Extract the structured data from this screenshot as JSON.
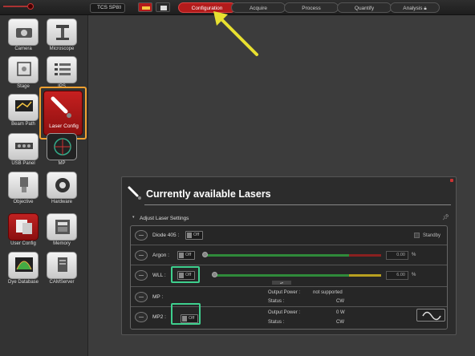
{
  "topbar": {
    "config_select": "TCS SP8",
    "steps": [
      "Configuration",
      "Acquire",
      "Process",
      "Quantify",
      "Analysis"
    ]
  },
  "sidebar": {
    "tools": [
      {
        "label": "Camera"
      },
      {
        "label": "Microscope"
      },
      {
        "label": "Stage"
      },
      {
        "label": "IPS"
      },
      {
        "label": "Beam Path"
      },
      {
        "label": "Laser Config"
      },
      {
        "label": "USB Panel"
      },
      {
        "label": "MP"
      },
      {
        "label": "Objective"
      },
      {
        "label": "Hardware"
      },
      {
        "label": "User Config"
      },
      {
        "label": "Memory"
      },
      {
        "label": "Dye Database"
      },
      {
        "label": "CAMServer"
      }
    ]
  },
  "panel": {
    "title": "Currently available Lasers",
    "section": "Adjust Laser Settings",
    "standby_label": "Standby",
    "lasers": [
      {
        "name": "Diode 405 :",
        "toggle": "Off"
      },
      {
        "name": "Argon :",
        "toggle": "Off",
        "value": "0.00",
        "unit": "%"
      },
      {
        "name": "WLL :",
        "toggle": "Off",
        "value": "6.00",
        "unit": "%"
      },
      {
        "name": "MP :",
        "output_power_label": "Output Power :",
        "output_power": "not supported",
        "status_label": "Status :",
        "status": "CW"
      },
      {
        "name": "MP2 :",
        "toggle": "Off",
        "output_power_label": "Output Power :",
        "output_power": "0 W",
        "status_label": "Status :",
        "status": "CW"
      }
    ]
  },
  "colors": {
    "accent_red": "#b31b1b",
    "highlight_orange": "#f0a030",
    "highlight_green": "#3ecf8e",
    "arrow_yellow": "#e8e030"
  }
}
